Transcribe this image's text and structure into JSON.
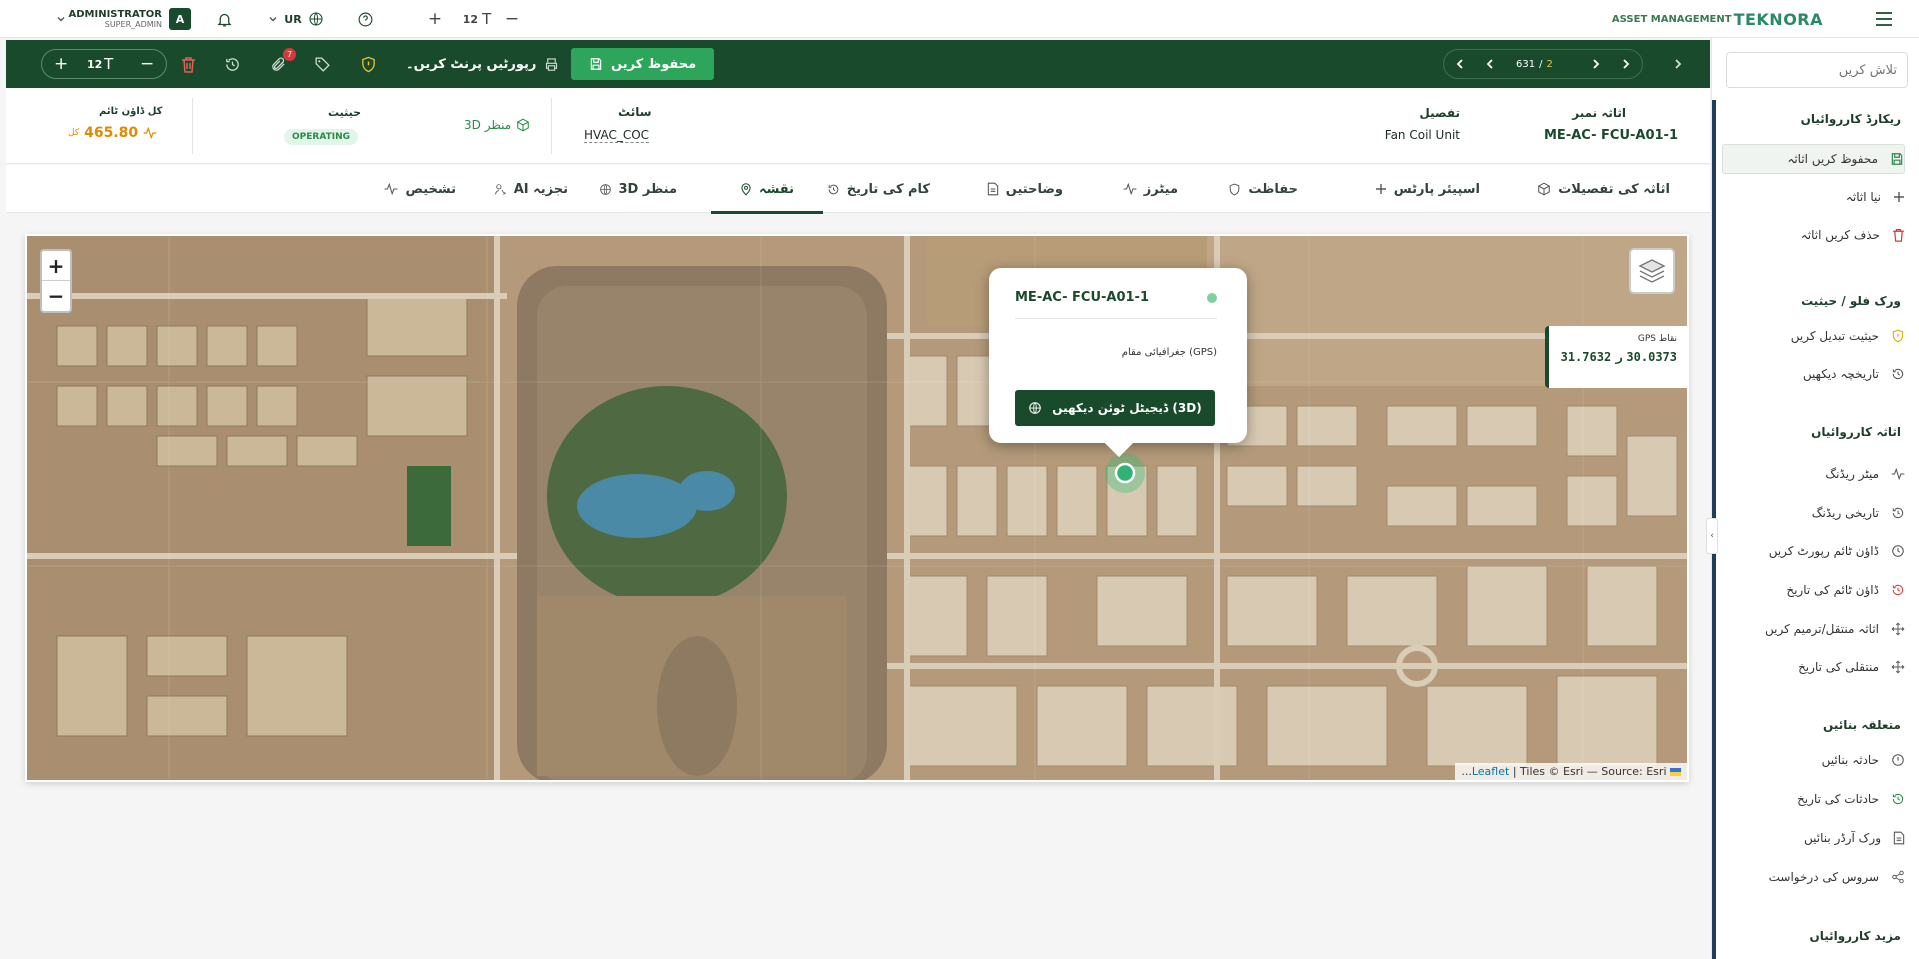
{
  "topbar": {
    "admin_name": "ADMINISTRATOR",
    "admin_role": "SUPER_ADMIN",
    "avatar_letter": "A",
    "language": "UR",
    "font_size": "12",
    "brand_small": "ASSET MANAGEMENT",
    "brand_name": "TEKNORA"
  },
  "actionbar": {
    "save_label": "محفوظ کریں",
    "print_label": "رپورٹیں پرنٹ کریں۔",
    "font_size": "12",
    "attachment_count": "7",
    "pager_current": "631",
    "pager_separator": "/",
    "pager_total": "2"
  },
  "info": {
    "asset_number_label": "اثاثہ نمبر",
    "asset_number_value": "ME-AC- FCU-A01-1",
    "details_label": "تفصیل",
    "details_value": "Fan Coil Unit",
    "site_label": "سائٹ",
    "site_value": "HVAC_COC",
    "view_3d_label": "3D منظر",
    "status_label": "حیثیت",
    "status_value": "OPERATING",
    "downtime_label": "کل ڈاؤن ٹائم",
    "downtime_value": "465.80",
    "downtime_unit": "کل"
  },
  "tabs": [
    {
      "label": "اثاثہ کی تفصیلات",
      "icon": "cube-icon"
    },
    {
      "label": "اسپیئر پارٹس",
      "icon": "plus-icon"
    },
    {
      "label": "حفاظت",
      "icon": "shield-icon"
    },
    {
      "label": "میٹرز",
      "icon": "pulse-icon"
    },
    {
      "label": "وضاحتیں",
      "icon": "document-icon"
    },
    {
      "label": "کام کی تاریخ",
      "icon": "history-icon"
    },
    {
      "label": "نقشہ",
      "icon": "map-pin-icon"
    },
    {
      "label": "3D منظر",
      "icon": "globe-icon"
    },
    {
      "label": "AI تجزیہ",
      "icon": "ai-icon"
    },
    {
      "label": "تشخیص",
      "icon": "pulse-icon"
    }
  ],
  "map": {
    "popup_title": "ME-AC- FCU-A01-1",
    "popup_location": "جغرافیائی مقام (GPS)",
    "popup_button": "ڈیجیٹل ٹوئن دیکھیں (3D)",
    "gps_label": "GPS نقاط",
    "gps_lat": "30.0373",
    "gps_sep": "ر",
    "gps_lng": "31.7632",
    "attribution_leaflet": "Leaflet",
    "attribution_rest": "| Tiles © Esri — Source: Esri",
    "attribution_prefix": "...",
    "zoom_in": "+",
    "zoom_out": "−"
  },
  "sidebar": {
    "search_placeholder": "تلاش کریں",
    "sections": [
      {
        "title": "ریکارڈ کارروائیاں",
        "items": [
          {
            "label": "محفوظ کریں اثاثہ",
            "icon": "save-icon",
            "active": true
          },
          {
            "label": "نیا اثاثہ",
            "icon": "plus-icon"
          },
          {
            "label": "حذف کریں اثاثہ",
            "icon": "trash-icon"
          }
        ]
      },
      {
        "title": "ورک فلو / حیثیت",
        "items": [
          {
            "label": "حیثیت تبدیل کریں",
            "icon": "shield-icon"
          },
          {
            "label": "تاریخچہ دیکھیں",
            "icon": "history-icon"
          }
        ]
      },
      {
        "title": "اثاثہ کارروائیاں",
        "items": [
          {
            "label": "میٹر ریڈنگ",
            "icon": "pulse-icon"
          },
          {
            "label": "تاریخی ریڈنگ",
            "icon": "history-icon"
          },
          {
            "label": "ڈاؤن ٹائم رپورٹ کریں",
            "icon": "clock-icon"
          },
          {
            "label": "ڈاؤن ٹائم کی تاریخ",
            "icon": "history-red-icon"
          },
          {
            "label": "اثاثہ منتقل/ترمیم کریں",
            "icon": "move-icon"
          },
          {
            "label": "منتقلی کی تاریخ",
            "icon": "move-icon"
          }
        ]
      },
      {
        "title": "متعلقہ بنائیں",
        "items": [
          {
            "label": "حادثہ بنائیں",
            "icon": "alert-icon"
          },
          {
            "label": "حادثات کی تاریخ",
            "icon": "history-green-icon"
          },
          {
            "label": "ورک آرڈر بنائیں",
            "icon": "document-icon"
          },
          {
            "label": "سروس کی درخواست",
            "icon": "share-icon"
          }
        ]
      },
      {
        "title": "مزید کارروائیاں",
        "items": []
      }
    ]
  },
  "colors": {
    "primary": "#1a4a2c",
    "accent": "#2da55a",
    "downtime": "#e08a00",
    "danger": "#d43a3a"
  }
}
